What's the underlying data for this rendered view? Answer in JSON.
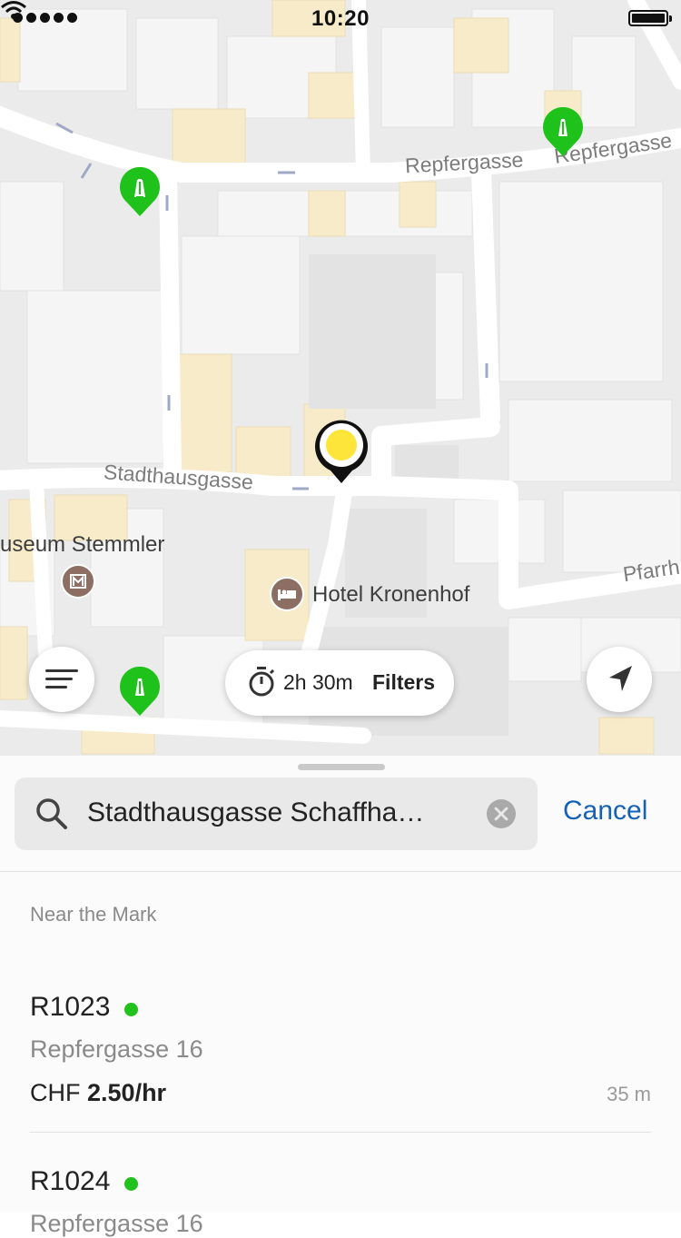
{
  "status_bar": {
    "time": "10:20"
  },
  "map": {
    "streets": [
      "Repfergasse",
      "Repfergasse",
      "Stadthausgasse",
      "Pfarrh"
    ],
    "pois": [
      {
        "label": "useum Stemmler",
        "icon": "museum-icon"
      },
      {
        "label": "Hotel Kronenhof",
        "icon": "hotel-icon"
      }
    ],
    "parking_pin_color": "#1fc21a",
    "selected_pin_color": "#fde53a"
  },
  "controls": {
    "menu_icon": "menu-icon",
    "duration": "2h 30m",
    "filters_label": "Filters",
    "locate_icon": "navigation-arrow-icon"
  },
  "search": {
    "value": "Stadthausgasse Schaffha…",
    "cancel_label": "Cancel"
  },
  "results": {
    "section_title": "Near the Mark",
    "items": [
      {
        "code": "R1023",
        "status_color": "#21c21b",
        "address": "Repfergasse 16",
        "currency": "CHF",
        "price": "2.50/hr",
        "distance": "35 m"
      },
      {
        "code": "R1024",
        "status_color": "#21c21b",
        "address": "Repfergasse 16"
      }
    ]
  },
  "colors": {
    "accent": "#1462b8"
  }
}
